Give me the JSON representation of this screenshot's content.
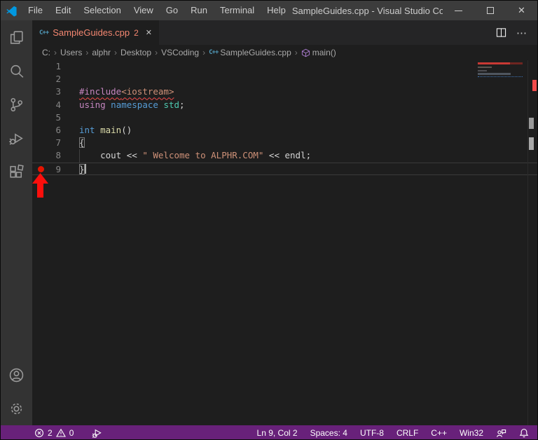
{
  "window": {
    "title": "SampleGuides.cpp - Visual Studio Code"
  },
  "menu": {
    "items": [
      "File",
      "Edit",
      "Selection",
      "View",
      "Go",
      "Run",
      "Terminal",
      "Help"
    ]
  },
  "tab": {
    "label": "SampleGuides.cpp",
    "badge": "2"
  },
  "breadcrumb": {
    "segments": [
      "C:",
      "Users",
      "alphr",
      "Desktop",
      "VSCoding"
    ],
    "file": "SampleGuides.cpp",
    "symbol": "main()"
  },
  "editor": {
    "lines": [
      {
        "num": "1",
        "tokens": []
      },
      {
        "num": "2",
        "tokens": []
      },
      {
        "num": "3",
        "error": true,
        "tokens": [
          {
            "t": "#include",
            "c": "kw"
          },
          {
            "t": "<iostream>",
            "c": "str"
          }
        ]
      },
      {
        "num": "4",
        "tokens": [
          {
            "t": "using",
            "c": "kw"
          },
          {
            "t": " ",
            "c": "fg"
          },
          {
            "t": "namespace",
            "c": "type"
          },
          {
            "t": " ",
            "c": "fg"
          },
          {
            "t": "std",
            "c": "cls"
          },
          {
            "t": ";",
            "c": "fg"
          }
        ]
      },
      {
        "num": "5",
        "tokens": []
      },
      {
        "num": "6",
        "tokens": [
          {
            "t": "int",
            "c": "type"
          },
          {
            "t": " ",
            "c": "fg"
          },
          {
            "t": "main",
            "c": "fn"
          },
          {
            "t": "()",
            "c": "fg"
          }
        ]
      },
      {
        "num": "7",
        "tokens": [
          {
            "t": "{",
            "c": "fg",
            "bracket": true
          }
        ]
      },
      {
        "num": "8",
        "guide": true,
        "tokens": [
          {
            "t": "    cout << ",
            "c": "fg"
          },
          {
            "t": "\" Welcome to ALPHR.COM\"",
            "c": "str"
          },
          {
            "t": " << endl;",
            "c": "fg"
          }
        ]
      },
      {
        "num": "9",
        "current": true,
        "cursor": true,
        "breakpoint": true,
        "tokens": [
          {
            "t": "}",
            "c": "fg",
            "bracket": true
          }
        ]
      }
    ]
  },
  "status_bar": {
    "errors": "2",
    "warnings": "0",
    "right": [
      "Ln 9, Col 2",
      "Spaces: 4",
      "UTF-8",
      "CRLF",
      "C++",
      "Win32"
    ]
  },
  "icons": {
    "close": "✕",
    "tab_close": "✕",
    "more_actions": "⋯",
    "breadcrumb_sep": "›",
    "cpp_glyph": "C++"
  },
  "colors": {
    "editor_bg": "#1E1E1E",
    "titlebar_bg": "#3C3C3C",
    "tabbar_bg": "#252526",
    "activitybar_bg": "#333333",
    "statusbar_bg": "#68217A",
    "tab_error_fg": "#F48771",
    "error_red": "#F14C4C",
    "breakpoint_red": "#E51400",
    "annotation_red": "#FB0F0C",
    "kw": "#C586C0",
    "type_blue": "#569CD6",
    "class_teal": "#4EC9B0",
    "func_yellow": "#DCDCAA",
    "string_orange": "#CE9178",
    "fg": "#D4D4D4",
    "line_number": "#858585"
  }
}
